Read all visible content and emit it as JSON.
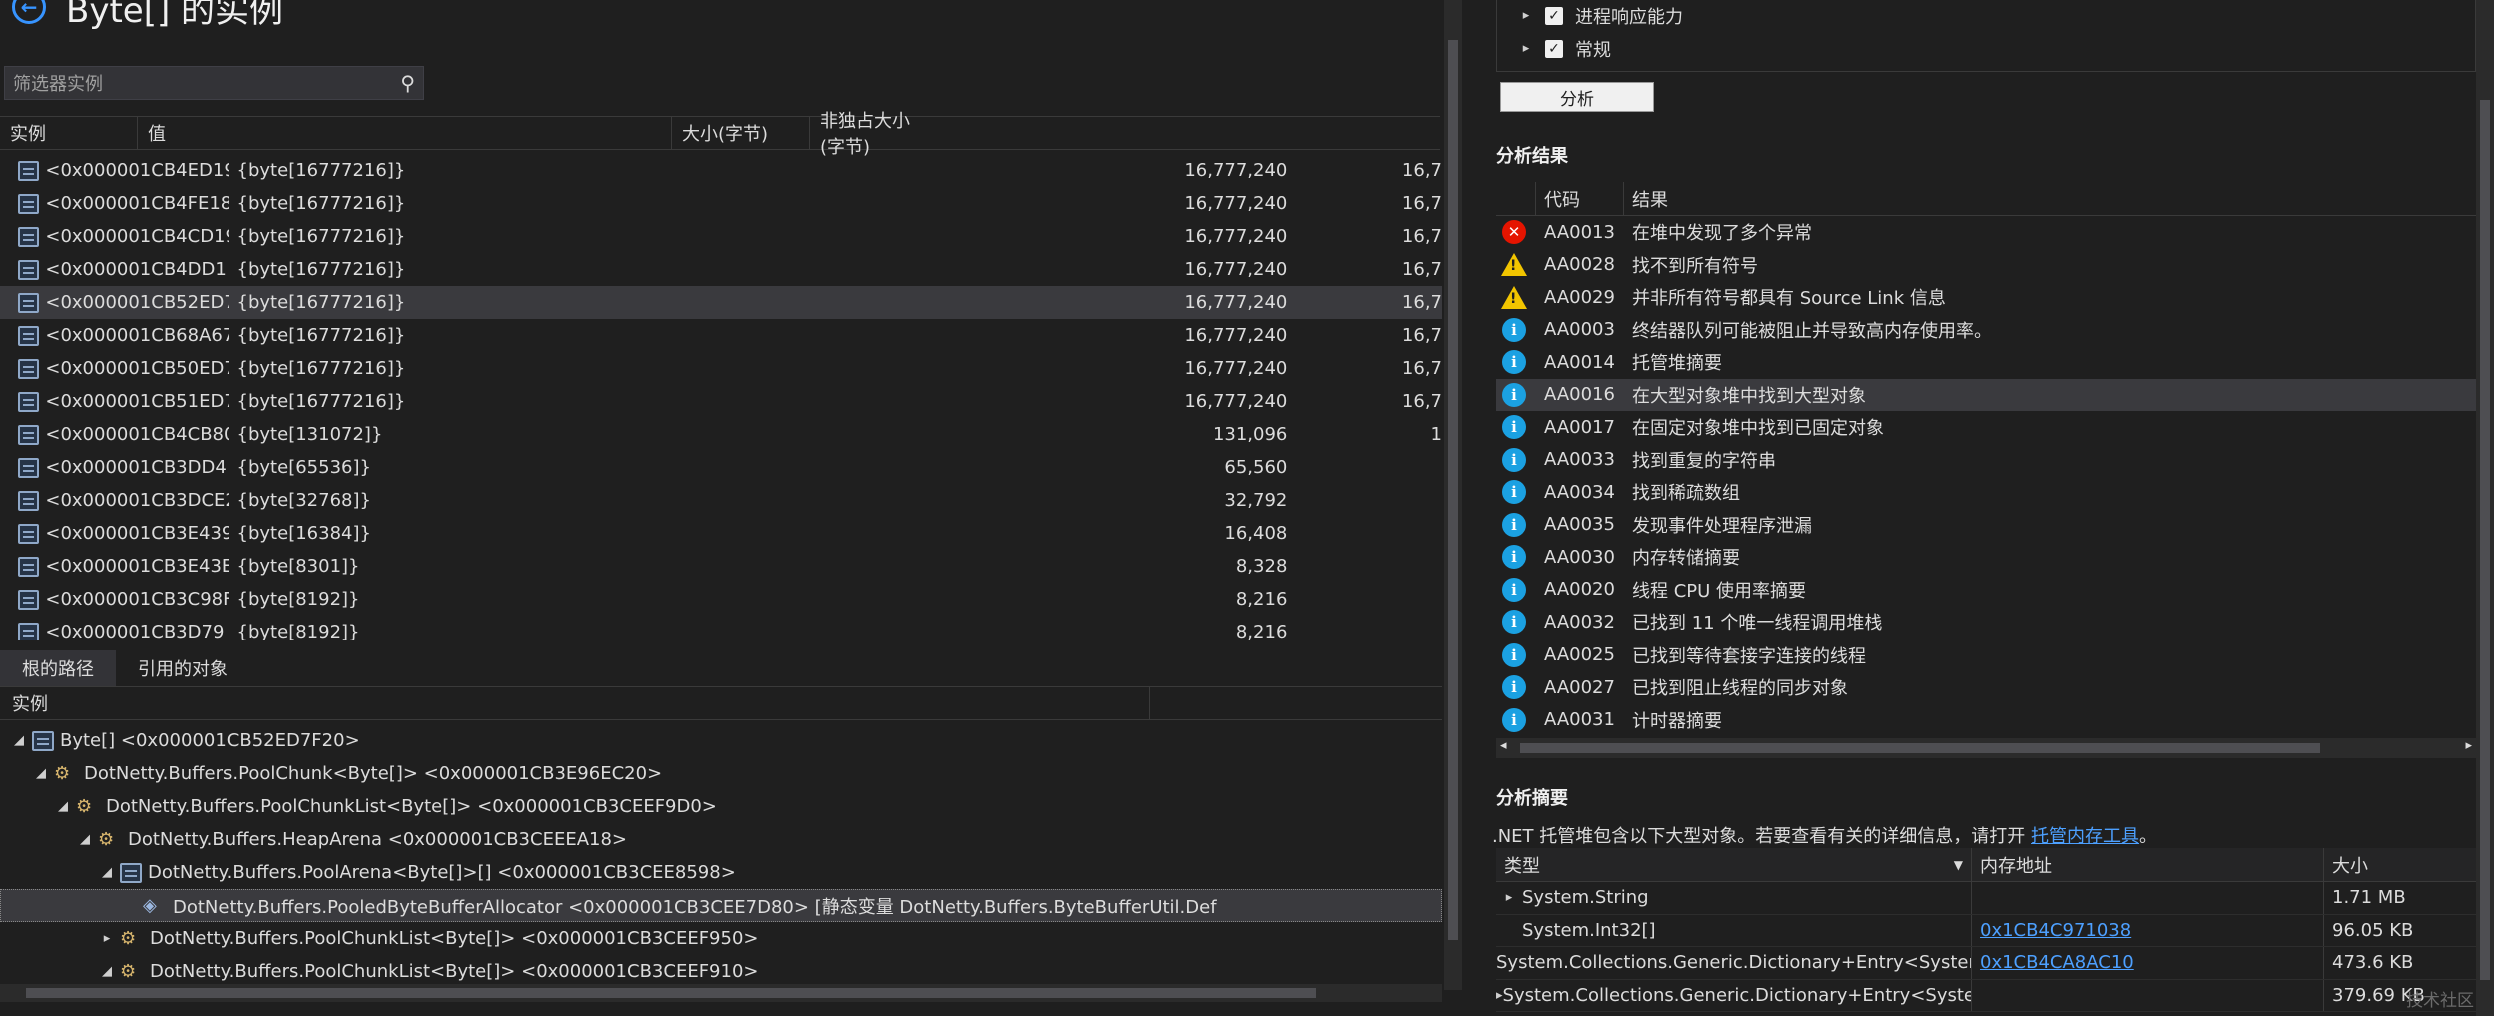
{
  "left": {
    "title": "Byte[] 的实例",
    "filter_placeholder": "筛选器实例",
    "columns": [
      "实例",
      "值",
      "大小(字节)",
      "非独占大小(字节)"
    ],
    "rows": [
      {
        "inst": "<0x000001CB4ED19",
        "val": "{byte[16777216]}",
        "size": "16,777,240",
        "excl": "16,7"
      },
      {
        "inst": "<0x000001CB4FE18",
        "val": "{byte[16777216]}",
        "size": "16,777,240",
        "excl": "16,7"
      },
      {
        "inst": "<0x000001CB4CD19",
        "val": "{byte[16777216]}",
        "size": "16,777,240",
        "excl": "16,7"
      },
      {
        "inst": "<0x000001CB4DD1",
        "val": "{byte[16777216]}",
        "size": "16,777,240",
        "excl": "16,7"
      },
      {
        "inst": "<0x000001CB52ED7",
        "val": "{byte[16777216]}",
        "size": "16,777,240",
        "excl": "16,7"
      },
      {
        "inst": "<0x000001CB68A67",
        "val": "{byte[16777216]}",
        "size": "16,777,240",
        "excl": "16,7"
      },
      {
        "inst": "<0x000001CB50ED7",
        "val": "{byte[16777216]}",
        "size": "16,777,240",
        "excl": "16,7"
      },
      {
        "inst": "<0x000001CB51ED7",
        "val": "{byte[16777216]}",
        "size": "16,777,240",
        "excl": "16,7"
      },
      {
        "inst": "<0x000001CB4CB80",
        "val": "{byte[131072]}",
        "size": "131,096",
        "excl": "1"
      },
      {
        "inst": "<0x000001CB3DD4",
        "val": "{byte[65536]}",
        "size": "65,560",
        "excl": ""
      },
      {
        "inst": "<0x000001CB3DCE2",
        "val": "{byte[32768]}",
        "size": "32,792",
        "excl": ""
      },
      {
        "inst": "<0x000001CB3E439",
        "val": "{byte[16384]}",
        "size": "16,408",
        "excl": ""
      },
      {
        "inst": "<0x000001CB3E43E",
        "val": "{byte[8301]}",
        "size": "8,328",
        "excl": ""
      },
      {
        "inst": "<0x000001CB3C98F",
        "val": "{byte[8192]}",
        "size": "8,216",
        "excl": ""
      },
      {
        "inst": "<0x000001CB3D79",
        "val": "{byte[8192]}",
        "size": "8,216",
        "excl": ""
      }
    ],
    "tabs": [
      "根的路径",
      "引用的对象"
    ],
    "tree_header": "实例",
    "tree": [
      {
        "indent": 0,
        "arrow": "◢",
        "icon": "obj",
        "text": "Byte[] <0x000001CB52ED7F20>"
      },
      {
        "indent": 1,
        "arrow": "◢",
        "icon": "gear",
        "text": "DotNetty.Buffers.PoolChunk<Byte[]> <0x000001CB3E96EC20>"
      },
      {
        "indent": 2,
        "arrow": "◢",
        "icon": "gear",
        "text": "DotNetty.Buffers.PoolChunkList<Byte[]> <0x000001CB3CEEF9D0>"
      },
      {
        "indent": 3,
        "arrow": "◢",
        "icon": "gear",
        "text": "DotNetty.Buffers.HeapArena <0x000001CB3CEEEA18>"
      },
      {
        "indent": 4,
        "arrow": "◢",
        "icon": "obj",
        "text": "DotNetty.Buffers.PoolArena<Byte[]>[] <0x000001CB3CEE8598>"
      },
      {
        "indent": 5,
        "arrow": "",
        "icon": "static",
        "text": "DotNetty.Buffers.PooledByteBufferAllocator <0x000001CB3CEE7D80> [静态变量 DotNetty.Buffers.ByteBufferUtil.Def"
      },
      {
        "indent": 4,
        "arrow": "▸",
        "icon": "gear",
        "text": "DotNetty.Buffers.PoolChunkList<Byte[]> <0x000001CB3CEEF950>"
      },
      {
        "indent": 4,
        "arrow": "◢",
        "icon": "gear",
        "text": "DotNetty.Buffers.PoolChunkList<Byte[]> <0x000001CB3CEEF910>"
      }
    ],
    "selected_row": 4,
    "selected_tree_row": 5
  },
  "right": {
    "checks": [
      {
        "label": "进程响应能力",
        "checked": "✓"
      },
      {
        "label": "常规",
        "checked": "✓"
      }
    ],
    "analyze_button": "分析",
    "results_title": "分析结果",
    "results_columns": [
      "代码",
      "结果"
    ],
    "results": [
      {
        "level": "err",
        "glyph": "✕",
        "code": "AA0013",
        "text": "在堆中发现了多个异常"
      },
      {
        "level": "warn",
        "glyph": "!",
        "code": "AA0028",
        "text": "找不到所有符号"
      },
      {
        "level": "warn",
        "glyph": "!",
        "code": "AA0029",
        "text": "并非所有符号都具有 Source Link 信息"
      },
      {
        "level": "info",
        "glyph": "i",
        "code": "AA0003",
        "text": "终结器队列可能被阻止并导致高内存使用率。"
      },
      {
        "level": "info",
        "glyph": "i",
        "code": "AA0014",
        "text": "托管堆摘要"
      },
      {
        "level": "info",
        "glyph": "i",
        "code": "AA0016",
        "text": "在大型对象堆中找到大型对象"
      },
      {
        "level": "info",
        "glyph": "i",
        "code": "AA0017",
        "text": "在固定对象堆中找到已固定对象"
      },
      {
        "level": "info",
        "glyph": "i",
        "code": "AA0033",
        "text": "找到重复的字符串"
      },
      {
        "level": "info",
        "glyph": "i",
        "code": "AA0034",
        "text": "找到稀疏数组"
      },
      {
        "level": "info",
        "glyph": "i",
        "code": "AA0035",
        "text": "发现事件处理程序泄漏"
      },
      {
        "level": "info",
        "glyph": "i",
        "code": "AA0030",
        "text": "内存转储摘要"
      },
      {
        "level": "info",
        "glyph": "i",
        "code": "AA0020",
        "text": "线程 CPU 使用率摘要"
      },
      {
        "level": "info",
        "glyph": "i",
        "code": "AA0032",
        "text": "已找到 11 个唯一线程调用堆栈"
      },
      {
        "level": "info",
        "glyph": "i",
        "code": "AA0025",
        "text": "已找到等待套接字连接的线程"
      },
      {
        "level": "info",
        "glyph": "i",
        "code": "AA0027",
        "text": "已找到阻止线程的同步对象"
      },
      {
        "level": "info",
        "glyph": "i",
        "code": "AA0031",
        "text": "计时器摘要"
      }
    ],
    "selected_result": 5,
    "summary_title": "分析摘要",
    "summary_text": ".NET 托管堆包含以下大型对象。若要查看有关的详细信息，请打开",
    "summary_link": "托管内存工具",
    "summary_end": "。",
    "summary_columns": [
      "类型",
      "内存地址",
      "大小"
    ],
    "summary_rows": [
      {
        "expand": "▸",
        "type": "System.String",
        "addr": "",
        "size": "1.71 MB"
      },
      {
        "expand": "",
        "type": "System.Int32[]",
        "addr": "0x1CB4C971038",
        "size": "96.05 KB"
      },
      {
        "expand": "",
        "type": "System.Collections.Generic.Dictionary+Entry<System....",
        "addr": "0x1CB4CA8AC10",
        "size": "473.6 KB"
      },
      {
        "expand": "▸",
        "type": "System.Collections.Generic.Dictionary+Entry<System....",
        "addr": "",
        "size": "379.69 KB"
      }
    ],
    "watermark": "技术社区"
  },
  "colors": {
    "accent": "#3794ff",
    "error": "#e51400",
    "warning": "#f2c500",
    "info": "#1ba1e2",
    "link": "#4da0ff"
  }
}
